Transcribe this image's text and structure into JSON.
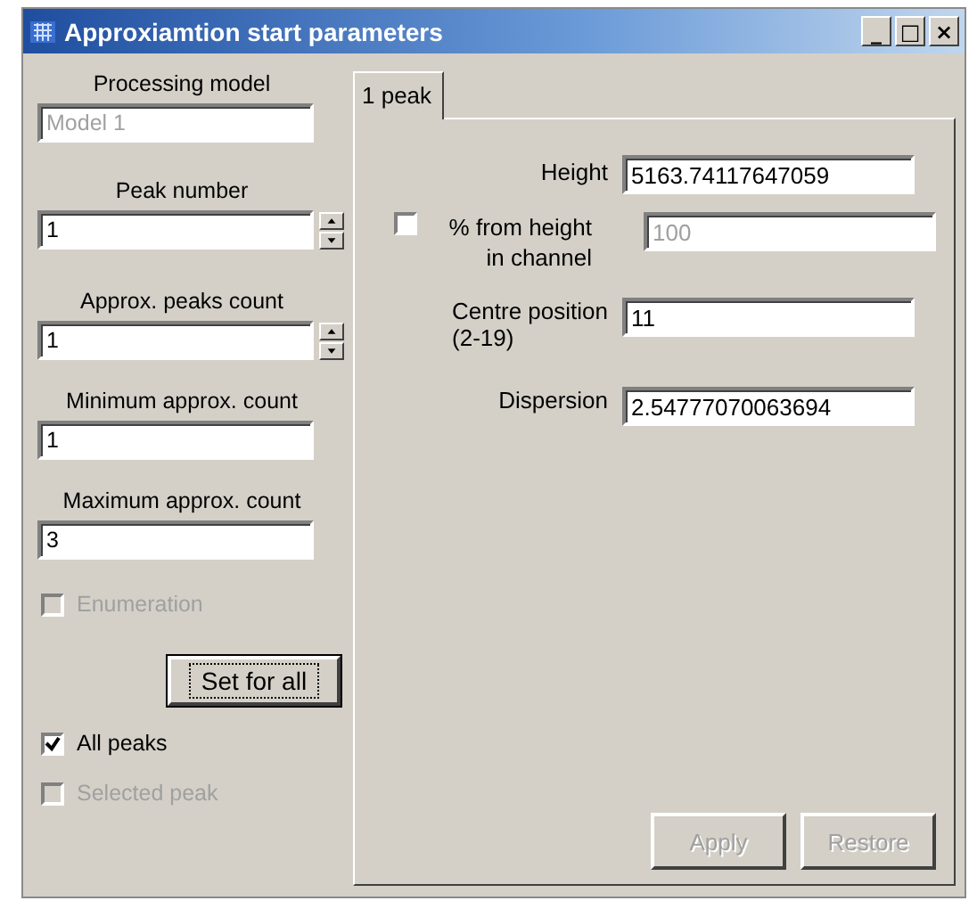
{
  "window": {
    "title": "Approxiamtion start parameters",
    "controls": [
      "_",
      "□",
      "×"
    ]
  },
  "left_fields": [
    {
      "label": "Processing model",
      "value": "Model 1",
      "kind": "text",
      "disabled": true
    },
    {
      "label": "Peak number",
      "value": "1",
      "kind": "spin",
      "disabled": false
    },
    {
      "label": "Approx. peaks count",
      "value": "1",
      "kind": "spin",
      "disabled": false
    },
    {
      "label": "Minimum approx. count",
      "value": "1",
      "kind": "text",
      "disabled": false
    },
    {
      "label": "Maximum approx. count",
      "value": "3",
      "kind": "text",
      "disabled": false
    }
  ],
  "enumeration": {
    "label": "Enumeration",
    "checked": false,
    "disabled": true
  },
  "set_button": {
    "label": "Set for all",
    "focused": true
  },
  "scope": [
    {
      "label": "All peaks",
      "checked": true,
      "disabled": false
    },
    {
      "label": "Selected peak",
      "checked": false,
      "disabled": true
    }
  ],
  "tabs": [
    {
      "label": "1 peak",
      "selected": true
    }
  ],
  "peak_fields": [
    {
      "kind": "text",
      "label": "Height",
      "value": "5163.74117647059",
      "disabled": false
    },
    {
      "kind": "check",
      "label": "% from height in channel",
      "value": "100",
      "checked": false,
      "disabled": true
    },
    {
      "kind": "text",
      "label": "Centre position",
      "sublabel": "(2-19)",
      "value": "11",
      "disabled": false
    },
    {
      "kind": "text",
      "label": "Dispersion",
      "value": "2.54777070063694",
      "disabled": false
    }
  ],
  "buttons": [
    {
      "label": "Apply",
      "disabled": true
    },
    {
      "label": "Restore",
      "disabled": true
    }
  ]
}
